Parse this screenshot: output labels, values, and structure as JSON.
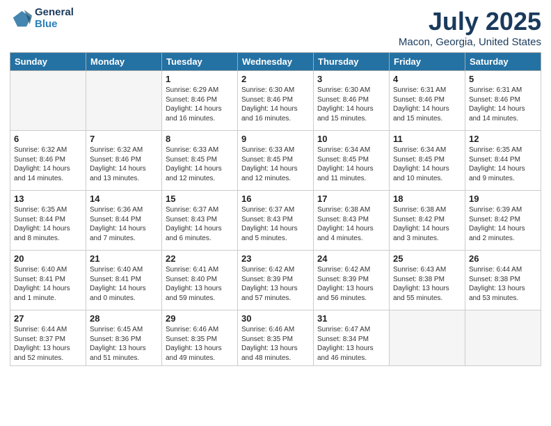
{
  "logo": {
    "line1": "General",
    "line2": "Blue"
  },
  "title": "July 2025",
  "subtitle": "Macon, Georgia, United States",
  "days_of_week": [
    "Sunday",
    "Monday",
    "Tuesday",
    "Wednesday",
    "Thursday",
    "Friday",
    "Saturday"
  ],
  "weeks": [
    [
      {
        "day": "",
        "info": ""
      },
      {
        "day": "",
        "info": ""
      },
      {
        "day": "1",
        "info": "Sunrise: 6:29 AM\nSunset: 8:46 PM\nDaylight: 14 hours and 16 minutes."
      },
      {
        "day": "2",
        "info": "Sunrise: 6:30 AM\nSunset: 8:46 PM\nDaylight: 14 hours and 16 minutes."
      },
      {
        "day": "3",
        "info": "Sunrise: 6:30 AM\nSunset: 8:46 PM\nDaylight: 14 hours and 15 minutes."
      },
      {
        "day": "4",
        "info": "Sunrise: 6:31 AM\nSunset: 8:46 PM\nDaylight: 14 hours and 15 minutes."
      },
      {
        "day": "5",
        "info": "Sunrise: 6:31 AM\nSunset: 8:46 PM\nDaylight: 14 hours and 14 minutes."
      }
    ],
    [
      {
        "day": "6",
        "info": "Sunrise: 6:32 AM\nSunset: 8:46 PM\nDaylight: 14 hours and 14 minutes."
      },
      {
        "day": "7",
        "info": "Sunrise: 6:32 AM\nSunset: 8:46 PM\nDaylight: 14 hours and 13 minutes."
      },
      {
        "day": "8",
        "info": "Sunrise: 6:33 AM\nSunset: 8:45 PM\nDaylight: 14 hours and 12 minutes."
      },
      {
        "day": "9",
        "info": "Sunrise: 6:33 AM\nSunset: 8:45 PM\nDaylight: 14 hours and 12 minutes."
      },
      {
        "day": "10",
        "info": "Sunrise: 6:34 AM\nSunset: 8:45 PM\nDaylight: 14 hours and 11 minutes."
      },
      {
        "day": "11",
        "info": "Sunrise: 6:34 AM\nSunset: 8:45 PM\nDaylight: 14 hours and 10 minutes."
      },
      {
        "day": "12",
        "info": "Sunrise: 6:35 AM\nSunset: 8:44 PM\nDaylight: 14 hours and 9 minutes."
      }
    ],
    [
      {
        "day": "13",
        "info": "Sunrise: 6:35 AM\nSunset: 8:44 PM\nDaylight: 14 hours and 8 minutes."
      },
      {
        "day": "14",
        "info": "Sunrise: 6:36 AM\nSunset: 8:44 PM\nDaylight: 14 hours and 7 minutes."
      },
      {
        "day": "15",
        "info": "Sunrise: 6:37 AM\nSunset: 8:43 PM\nDaylight: 14 hours and 6 minutes."
      },
      {
        "day": "16",
        "info": "Sunrise: 6:37 AM\nSunset: 8:43 PM\nDaylight: 14 hours and 5 minutes."
      },
      {
        "day": "17",
        "info": "Sunrise: 6:38 AM\nSunset: 8:43 PM\nDaylight: 14 hours and 4 minutes."
      },
      {
        "day": "18",
        "info": "Sunrise: 6:38 AM\nSunset: 8:42 PM\nDaylight: 14 hours and 3 minutes."
      },
      {
        "day": "19",
        "info": "Sunrise: 6:39 AM\nSunset: 8:42 PM\nDaylight: 14 hours and 2 minutes."
      }
    ],
    [
      {
        "day": "20",
        "info": "Sunrise: 6:40 AM\nSunset: 8:41 PM\nDaylight: 14 hours and 1 minute."
      },
      {
        "day": "21",
        "info": "Sunrise: 6:40 AM\nSunset: 8:41 PM\nDaylight: 14 hours and 0 minutes."
      },
      {
        "day": "22",
        "info": "Sunrise: 6:41 AM\nSunset: 8:40 PM\nDaylight: 13 hours and 59 minutes."
      },
      {
        "day": "23",
        "info": "Sunrise: 6:42 AM\nSunset: 8:39 PM\nDaylight: 13 hours and 57 minutes."
      },
      {
        "day": "24",
        "info": "Sunrise: 6:42 AM\nSunset: 8:39 PM\nDaylight: 13 hours and 56 minutes."
      },
      {
        "day": "25",
        "info": "Sunrise: 6:43 AM\nSunset: 8:38 PM\nDaylight: 13 hours and 55 minutes."
      },
      {
        "day": "26",
        "info": "Sunrise: 6:44 AM\nSunset: 8:38 PM\nDaylight: 13 hours and 53 minutes."
      }
    ],
    [
      {
        "day": "27",
        "info": "Sunrise: 6:44 AM\nSunset: 8:37 PM\nDaylight: 13 hours and 52 minutes."
      },
      {
        "day": "28",
        "info": "Sunrise: 6:45 AM\nSunset: 8:36 PM\nDaylight: 13 hours and 51 minutes."
      },
      {
        "day": "29",
        "info": "Sunrise: 6:46 AM\nSunset: 8:35 PM\nDaylight: 13 hours and 49 minutes."
      },
      {
        "day": "30",
        "info": "Sunrise: 6:46 AM\nSunset: 8:35 PM\nDaylight: 13 hours and 48 minutes."
      },
      {
        "day": "31",
        "info": "Sunrise: 6:47 AM\nSunset: 8:34 PM\nDaylight: 13 hours and 46 minutes."
      },
      {
        "day": "",
        "info": ""
      },
      {
        "day": "",
        "info": ""
      }
    ]
  ]
}
